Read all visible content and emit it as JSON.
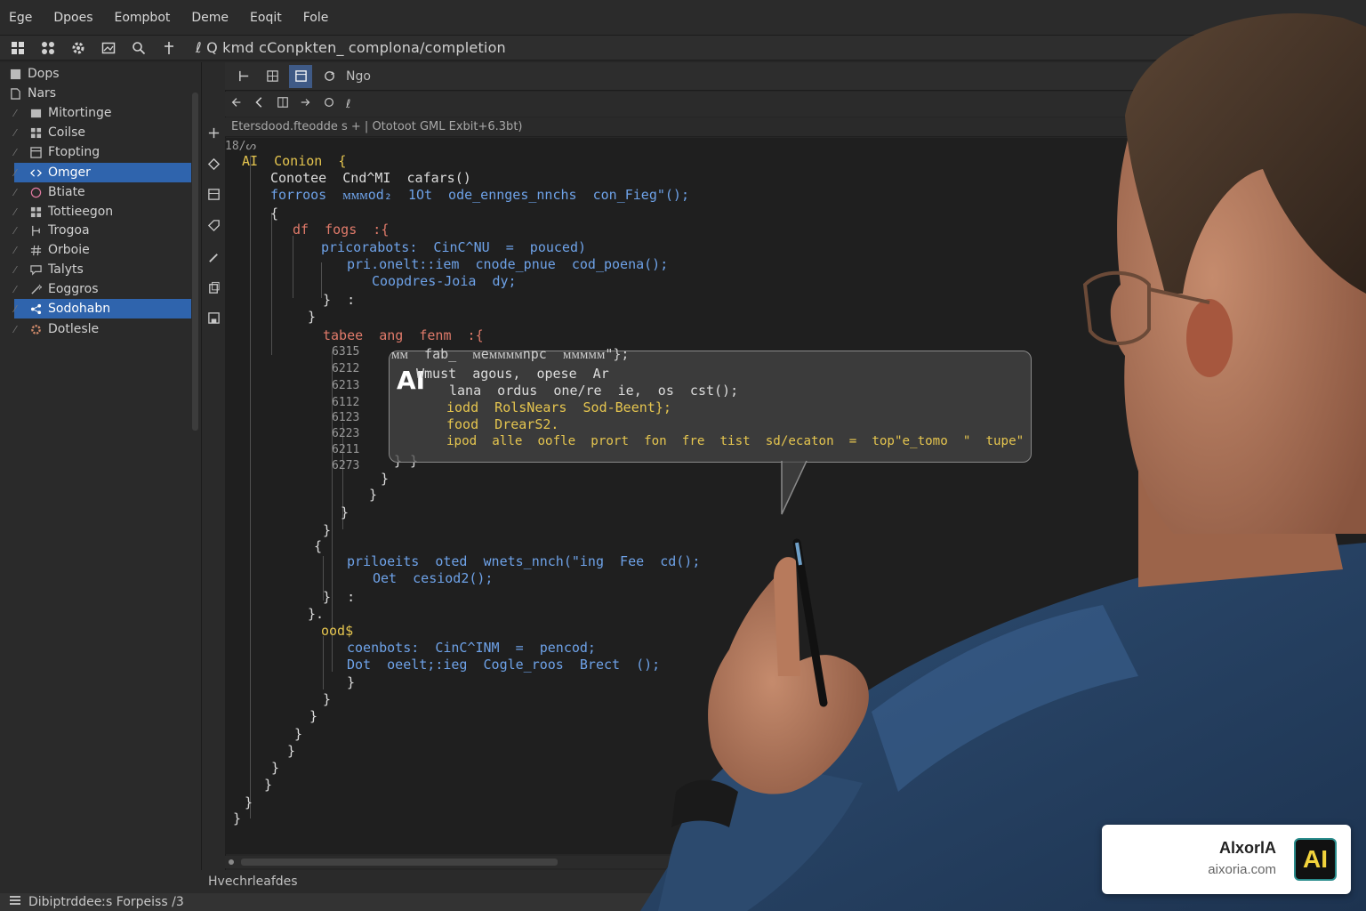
{
  "menu": [
    "Ege",
    "Dpoes",
    "Eompbot",
    "Deme",
    "Eoqit",
    "Fole"
  ],
  "toolbar": {
    "path": "ℓ Q  kmd cConpkten_ complona/completion"
  },
  "sidebar": {
    "items": [
      {
        "label": "Dops",
        "icon": "square-icon"
      },
      {
        "label": "Nars",
        "icon": "page-icon"
      },
      {
        "label": "Mitortinge",
        "icon": "folder-icon"
      },
      {
        "label": "Coilse",
        "icon": "grid-icon"
      },
      {
        "label": "Ftopting",
        "icon": "window-icon"
      },
      {
        "label": "Omger",
        "icon": "code-icon",
        "selected": true
      },
      {
        "label": "Btiate",
        "icon": "circle-icon"
      },
      {
        "label": "Tottieegon",
        "icon": "grid-icon"
      },
      {
        "label": "Trogoa",
        "icon": "branch-icon"
      },
      {
        "label": "Orboie",
        "icon": "hash-icon"
      },
      {
        "label": "Talyts",
        "icon": "chat-icon"
      },
      {
        "label": "Eoggros",
        "icon": "wand-icon"
      },
      {
        "label": "Sodohabn",
        "icon": "share-icon",
        "selected": true
      },
      {
        "label": "Dotlesle",
        "icon": "gear-icon"
      }
    ]
  },
  "editor_tabs": {
    "label": "Ngo"
  },
  "nav": {
    "label": "ℓ"
  },
  "breadcrumb": "Etersdood.fteodde s  +  |  Ototoot  GML Exbit+6.3bt)",
  "code": {
    "header": "18/ᔕ",
    "lines": [
      {
        "text": "AI  Conion  {",
        "color": "yellow"
      },
      {
        "text": "Conotee  Cnd^MI  cafars()",
        "color": "white"
      },
      {
        "text": "forroos  ᴍᴍᴍod₂  1Ot  ode_ennges_nnchs  con_Fieg\"();",
        "color": "blue"
      },
      {
        "text": "{",
        "color": "white"
      },
      {
        "text": "df  fogs  :{",
        "color": "red"
      },
      {
        "text": "pricorabots:  CinC^NU  =  pouced)",
        "color": "blue"
      },
      {
        "text": "pri.onelt::iem  cnode_pnue  cod_poena();",
        "color": "blue"
      },
      {
        "text": "Coopdres-Joia  dy;",
        "color": "blue"
      },
      {
        "text": "}  :",
        "color": "white"
      },
      {
        "text": "}",
        "color": "white"
      },
      {
        "text": "tabee  ang  fenm  :{",
        "color": "red"
      },
      {
        "text": "priloeits  oted  wnets_nnch(\"ing  Fee  cd();",
        "color": "blue"
      },
      {
        "text": "Oet  cesiod2();",
        "color": "blue"
      },
      {
        "text": "}  :",
        "color": "white"
      },
      {
        "text": "}.",
        "color": "white"
      },
      {
        "text": "ood$",
        "color": "yellow"
      },
      {
        "text": "coenbots:  CinC^INM  =  pencod;",
        "color": "blue"
      },
      {
        "text": "Dot  oeelt;:ieg  Cogle_roos  Brect  ();",
        "color": "blue"
      },
      {
        "text": "}",
        "color": "white"
      }
    ],
    "line_numbers": [
      "6315",
      "6212",
      "6213",
      "6112",
      "6123",
      "6223",
      "6211",
      "6273"
    ]
  },
  "ai_popup": {
    "label": "AI",
    "lines": [
      {
        "text": "Wmust  agous,  opese  Ar",
        "color": "white"
      },
      {
        "text": "lana  ordus  one/re  ie,  os  cst();",
        "color": "white"
      },
      {
        "text": "iodd  RolsNears  Sod-Beent};",
        "color": "yellow"
      },
      {
        "text": "food  DrearS2.",
        "color": "yellow"
      },
      {
        "text": "ipod  alle  oofle  prort  fon  fre  tist  sd/ecaton  =  top\"e_tomo  \"  tupe\"",
        "color": "yellow"
      }
    ],
    "header_line": "ᴍᴍ  fab_  ᴍeᴍᴍᴍᴍnpc  ᴍᴍᴍᴍᴍ\"};"
  },
  "panel": {
    "label": "Hvechrleafdes"
  },
  "status": {
    "label": "Dibiptrddeeːs Forpeiss /3"
  },
  "brand": {
    "name": "AlxorlA",
    "url": "aixoria.com",
    "logo": "AI"
  },
  "colors": {
    "selection": "#2f64ad",
    "editor_bg": "#1f1f1f",
    "accent_yellow": "#e5c54f",
    "accent_blue": "#6ea2e8"
  }
}
